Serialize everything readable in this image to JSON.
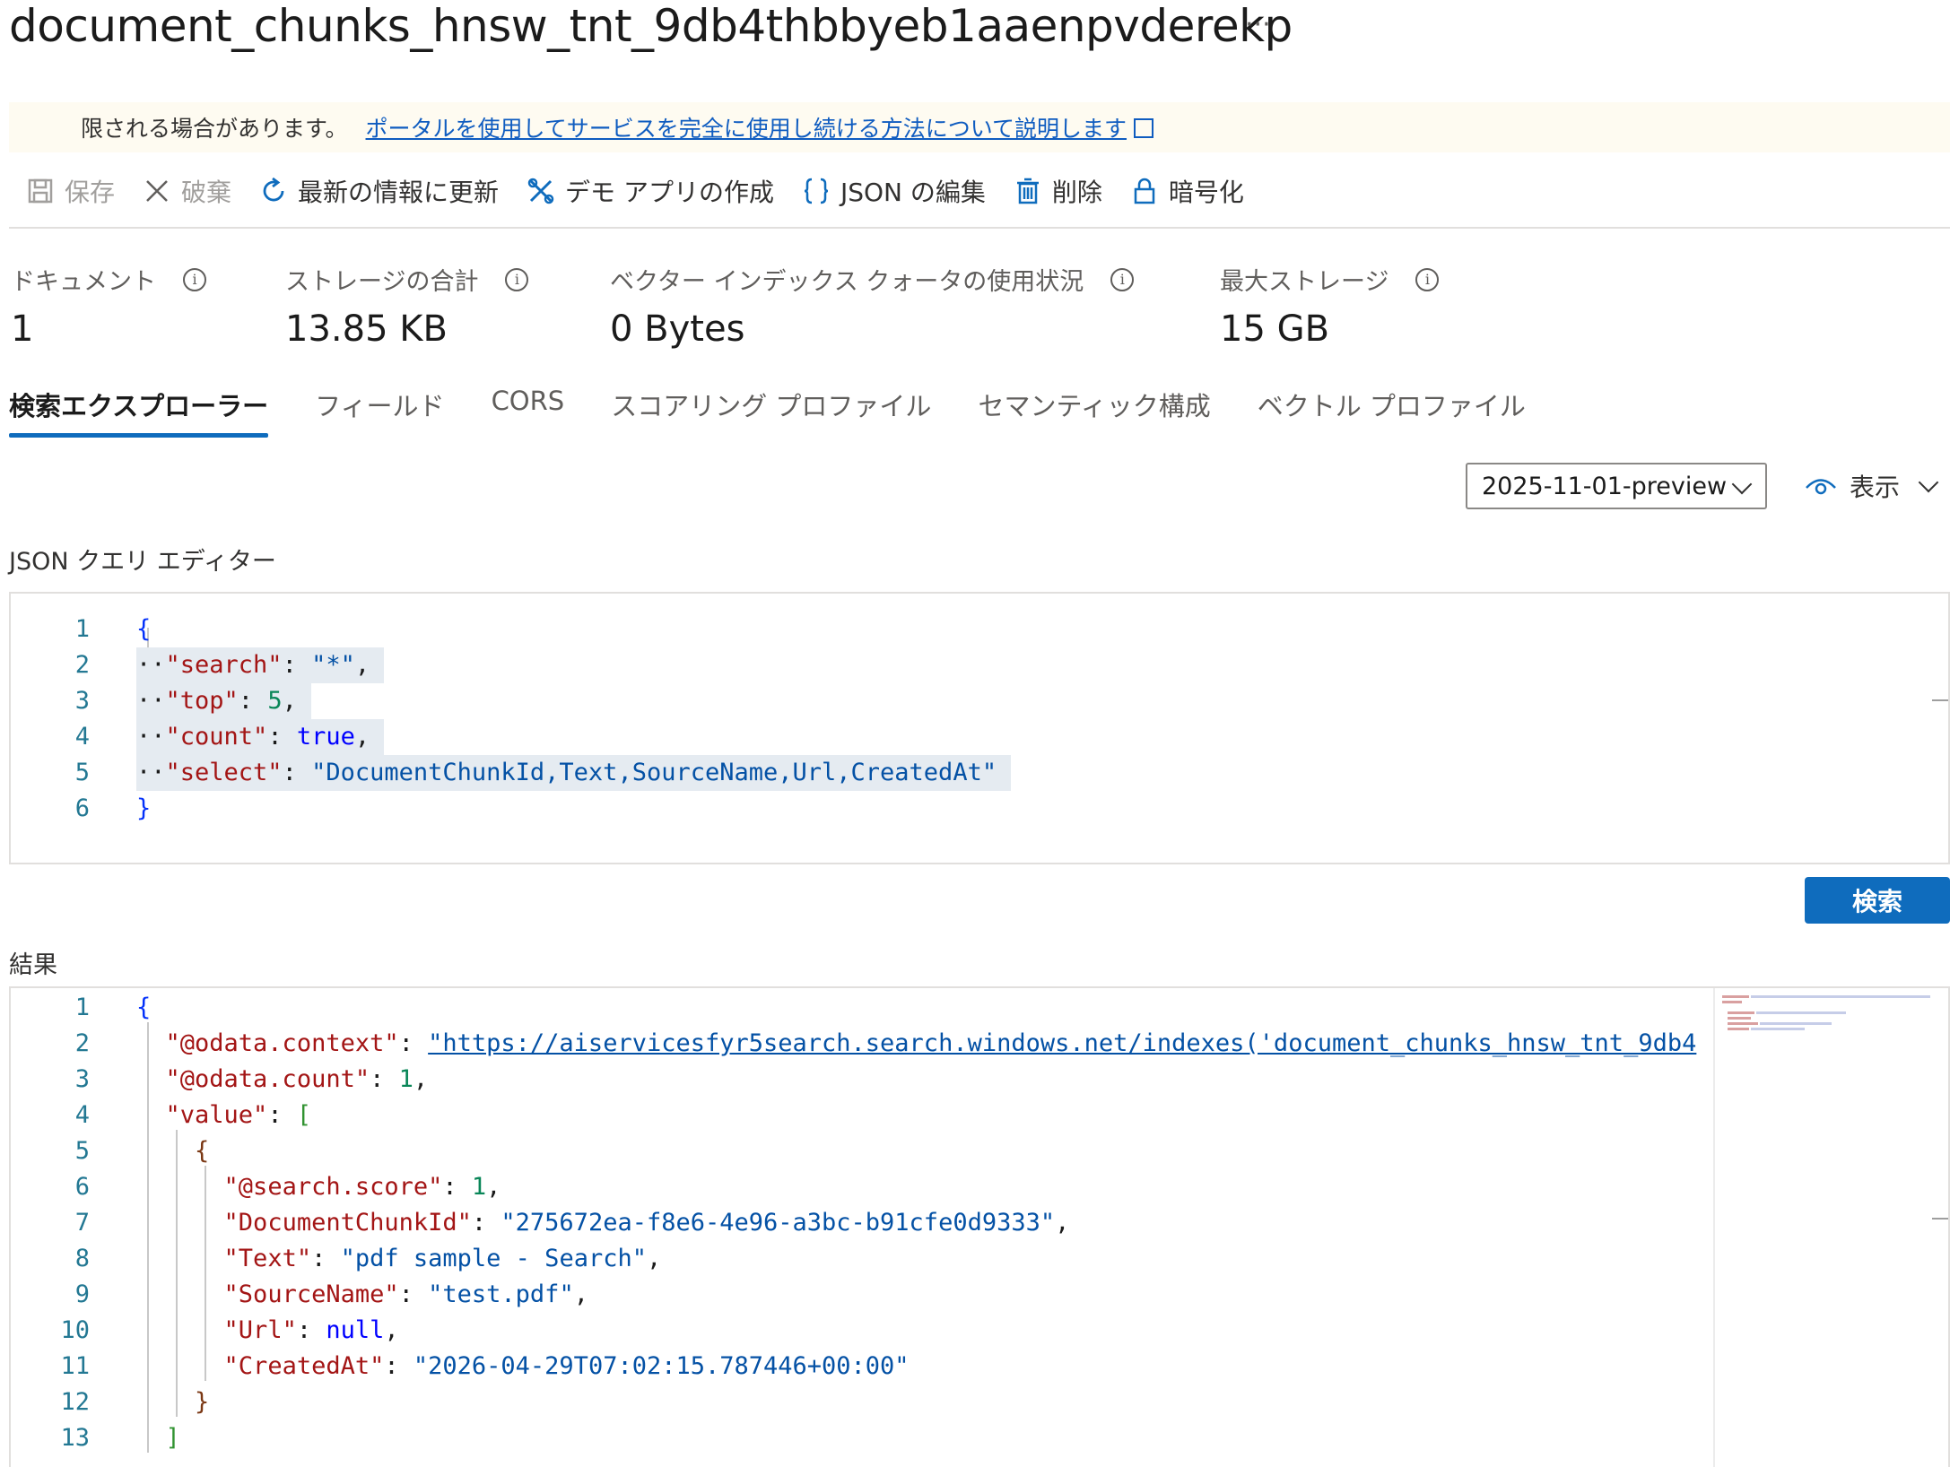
{
  "header": {
    "title": "document_chunks_hnsw_tnt_9db4thbbyeb1aaenpvderekp",
    "more_label": "···"
  },
  "notice": {
    "text": "限される場合があります。",
    "link": "ポータルを使用してサービスを完全に使用し続ける方法について説明します"
  },
  "toolbar": {
    "save": "保存",
    "discard": "破棄",
    "refresh": "最新の情報に更新",
    "demo_app": "デモ アプリの作成",
    "edit_json": "JSON の編集",
    "delete": "削除",
    "encrypt": "暗号化"
  },
  "stats": {
    "documents_label": "ドキュメント",
    "documents_value": "1",
    "storage_label": "ストレージの合計",
    "storage_value": "13.85 KB",
    "vector_label": "ベクター インデックス クォータの使用状況",
    "vector_value": "0 Bytes",
    "max_label": "最大ストレージ",
    "max_value": "15 GB"
  },
  "tabs": {
    "explorer": "検索エクスプローラー",
    "fields": "フィールド",
    "cors": "CORS",
    "scoring": "スコアリング プロファイル",
    "semantic": "セマンティック構成",
    "vector": "ベクトル プロファイル"
  },
  "controls": {
    "api_version": "2025-11-01-preview",
    "view": "表示",
    "search_button": "検索"
  },
  "query_editor": {
    "label": "JSON クエリ エディター",
    "lines": {
      "n1": "1",
      "n2": "2",
      "n3": "3",
      "n4": "4",
      "n5": "5",
      "n6": "6",
      "open": "{",
      "k_search": "\"search\"",
      "v_search": "\"*\"",
      "k_top": "\"top\"",
      "v_top": "5",
      "k_count": "\"count\"",
      "v_count": "true",
      "k_select": "\"select\"",
      "v_select": "\"DocumentChunkId,Text,SourceName,Url,CreatedAt\"",
      "close": "}"
    }
  },
  "results": {
    "label": "結果",
    "lines": {
      "n1": "1",
      "n2": "2",
      "n3": "3",
      "n4": "4",
      "n5": "5",
      "n6": "6",
      "n7": "7",
      "n8": "8",
      "n9": "9",
      "n10": "10",
      "n11": "11",
      "n12": "12",
      "n13": "13",
      "open": "{",
      "k_context": "\"@odata.context\"",
      "v_context": "\"https://aiservicesfyr5search.search.windows.net/indexes('document_chunks_hnsw_tnt_9db4",
      "k_count": "\"@odata.count\"",
      "v_count": "1",
      "k_value": "\"value\"",
      "v_value_open": "[",
      "obj_open": "{",
      "k_score": "\"@search.score\"",
      "v_score": "1",
      "k_chunkid": "\"DocumentChunkId\"",
      "v_chunkid": "\"275672ea-f8e6-4e96-a3bc-b91cfe0d9333\"",
      "k_text": "\"Text\"",
      "v_text": "\"pdf sample - Search\"",
      "k_source": "\"SourceName\"",
      "v_source": "\"test.pdf\"",
      "k_url": "\"Url\"",
      "v_url": "null",
      "k_created": "\"CreatedAt\"",
      "v_created": "\"2026-04-29T07:02:15.787446+00:00\"",
      "obj_close": "}",
      "arr_close": "]"
    }
  }
}
